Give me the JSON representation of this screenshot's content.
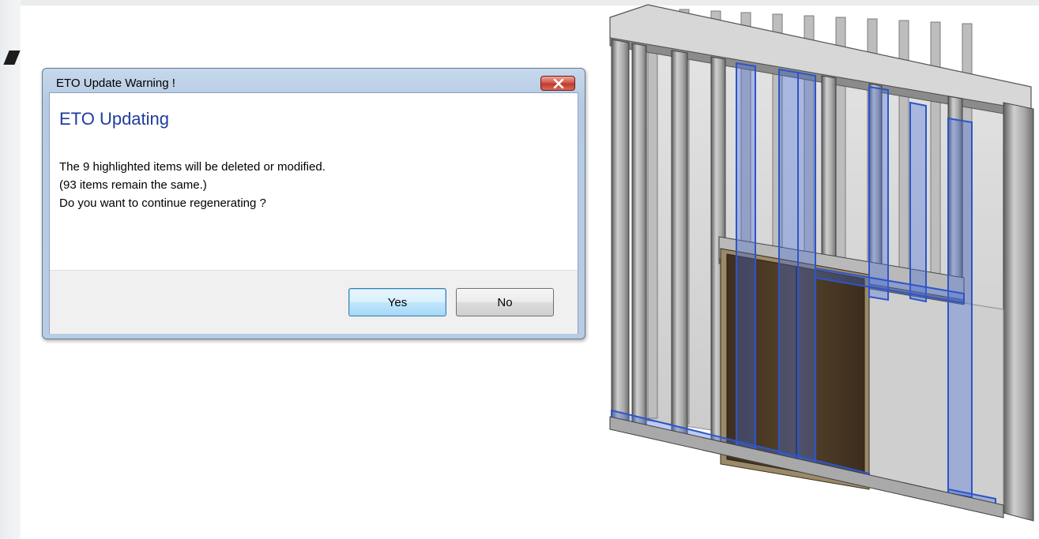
{
  "dialog": {
    "title": "ETO Update Warning !",
    "heading": "ETO Updating",
    "message_lines": [
      "The 9 highlighted items will be deleted or modified.",
      "(93 items remain the same.)",
      "Do you want to continue regenerating ?"
    ],
    "buttons": {
      "yes_label": "Yes",
      "no_label": "No"
    },
    "close_icon": "close-icon"
  },
  "illustration": {
    "subject": "framed-wall-with-door-3d-view",
    "colors": {
      "stud_gray": "#9a9a9a",
      "highlight_blue": "#2d55c8",
      "door_brown": "#4a3a26",
      "sheathing": "#d4d4d4"
    }
  },
  "colors": {
    "heading_blue": "#1f3d9a",
    "frame_blue": "#b8cde4",
    "close_red": "#c03a2c"
  }
}
